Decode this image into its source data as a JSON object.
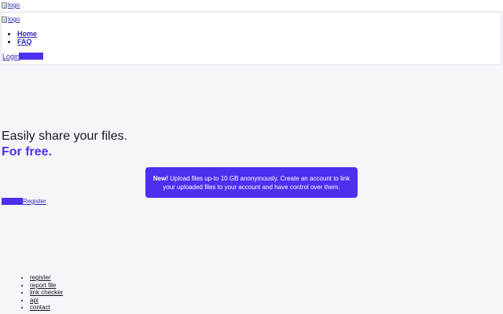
{
  "top_logo": {
    "alt": "logo"
  },
  "header": {
    "logo_alt": "logo",
    "nav": [
      {
        "label": "Home"
      },
      {
        "label": "FAQ"
      }
    ],
    "login_label": "Login"
  },
  "hero": {
    "title": "Easily share your files.",
    "subtitle": "For free."
  },
  "notice": {
    "highlight": "New!",
    "text": " Upload files up-to 10 GB anonymously. Create an account to link your uploaded files to your account and have control over them."
  },
  "cta": {
    "register_label": "Register"
  },
  "footer": {
    "links": [
      {
        "label": "register"
      },
      {
        "label": "report file"
      },
      {
        "label": "link checker"
      },
      {
        "label": "api"
      },
      {
        "label": "contact"
      }
    ]
  },
  "colors": {
    "accent": "#4b30f0",
    "background": "#f5f6fa",
    "link": "#2f2ab0"
  }
}
